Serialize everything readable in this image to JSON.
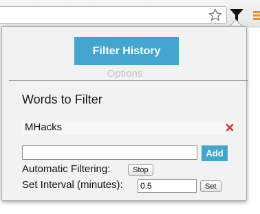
{
  "browser": {
    "icons": {
      "bookmark": "star-icon",
      "extension": "funnel-icon",
      "menu": "menu-icon"
    }
  },
  "popup": {
    "filter_history_label": "Filter History",
    "options_label": "Options",
    "words_title": "Words to Filter",
    "words": [
      {
        "text": "MHacks"
      }
    ],
    "remove_icon": "close-icon",
    "new_word_value": "",
    "add_label": "Add",
    "auto_filter_label": "Automatic Filtering:",
    "stop_label": "Stop",
    "interval_label": "Set Interval (minutes):",
    "interval_value": "0.5",
    "set_label": "Set",
    "colors": {
      "accent": "#42a6cf",
      "remove": "#e03030",
      "options_text": "#c4c4c4"
    }
  }
}
